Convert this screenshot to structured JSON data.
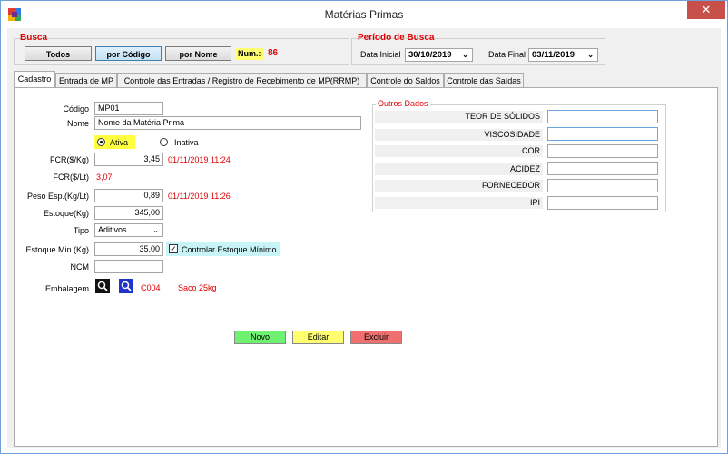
{
  "window": {
    "title": "Matérias Primas",
    "close_glyph": "✕"
  },
  "busca": {
    "title": "Busca",
    "buttons": {
      "todos": "Todos",
      "por_codigo": "por Código",
      "por_nome": "por Nome"
    },
    "num_label": "Num.:",
    "num_value": "86"
  },
  "periodo": {
    "title": "Período de Busca",
    "data_inicial_label": "Data Inicial",
    "data_inicial": "30/10/2019",
    "data_final_label": "Data Final",
    "data_final": "03/11/2019"
  },
  "tabs": [
    {
      "label": "Cadastro"
    },
    {
      "label": "Entrada de MP"
    },
    {
      "label": "Controle das Entradas / Registro de Recebimento de MP(RRMP)"
    },
    {
      "label": "Controle do Saldos"
    },
    {
      "label": "Controle das Saídas"
    }
  ],
  "cadastro": {
    "codigo_label": "Código",
    "codigo": "MP01",
    "nome_label": "Nome",
    "nome": "Nome da Matéria Prima",
    "ativa_label": "Ativa",
    "inativa_label": "Inativa",
    "fcr_kg_label": "FCR($/Kg)",
    "fcr_kg": "3,45",
    "fcr_kg_date": "01/11/2019 11:24",
    "fcr_lt_label": "FCR($/Lt)",
    "fcr_lt": "3,07",
    "peso_label": "Peso Esp.(Kg/Lt)",
    "peso": "0,89",
    "peso_date": "01/11/2019 11:26",
    "estoque_label": "Estoque(Kg)",
    "estoque": "345,00",
    "tipo_label": "Tipo",
    "tipo": "Aditivos",
    "estoque_min_label": "Estoque Min.(Kg)",
    "estoque_min": "35,00",
    "controlar_label": "Controlar Estoque Mínimo",
    "ncm_label": "NCM",
    "ncm": "",
    "embalagem_label": "Embalagem",
    "embalagem_code": "C004",
    "embalagem_desc": "Saco 25kg"
  },
  "outros": {
    "title": "Outros Dados",
    "rows": [
      "TEOR DE SÓLIDOS",
      "VISCOSIDADE",
      "COR",
      "ACIDEZ",
      "FORNECEDOR",
      "IPI"
    ]
  },
  "actions": {
    "novo": "Novo",
    "editar": "Editar",
    "excluir": "Excluir"
  },
  "colors": {
    "novo": "#70f070",
    "editar": "#ffff70",
    "excluir": "#f07070",
    "accent_red": "#e00000"
  }
}
